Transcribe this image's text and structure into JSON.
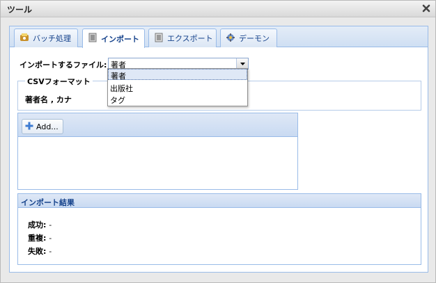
{
  "window": {
    "title": "ツール"
  },
  "tabs": [
    {
      "label": "バッチ処理",
      "icon": "batch-icon",
      "active": false
    },
    {
      "label": "インポート",
      "icon": "import-icon",
      "active": true
    },
    {
      "label": "エクスポート",
      "icon": "export-icon",
      "active": false
    },
    {
      "label": "デーモン",
      "icon": "daemon-icon",
      "active": false
    }
  ],
  "import": {
    "file_label": "インポートするファイル:",
    "file_value": "著者",
    "options": [
      "著者",
      "出版社",
      "タグ"
    ],
    "selected_option": "著者"
  },
  "csv_format": {
    "legend": "CSVフォーマット",
    "text": "著者名 , カナ"
  },
  "grid": {
    "add_label": "Add..."
  },
  "results": {
    "title": "インポート結果",
    "rows": [
      {
        "label": "成功:",
        "value": "-"
      },
      {
        "label": "重複:",
        "value": "-"
      },
      {
        "label": "失敗:",
        "value": "-"
      }
    ]
  },
  "colors": {
    "accent": "#99bbe8",
    "header_text": "#15428b"
  }
}
